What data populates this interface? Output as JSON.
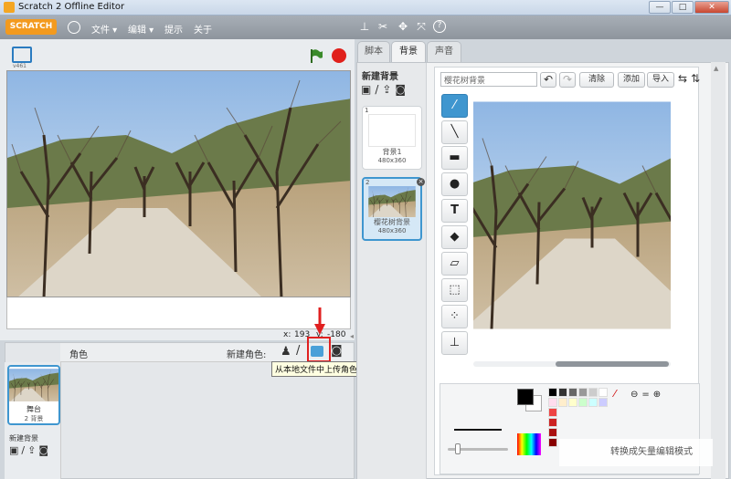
{
  "window": {
    "title": "Scratch 2 Offline Editor",
    "minimize": "—",
    "maximize": "□",
    "close": "✕"
  },
  "menubar": {
    "logo": "SCRATCH",
    "file": "文件 ▾",
    "edit": "编辑 ▾",
    "tips": "提示",
    "about": "关于"
  },
  "stage": {
    "version_label": "v461",
    "coord_x_label": "x:",
    "coord_x": "193",
    "coord_y_label": "y:",
    "coord_y": "-180"
  },
  "sprites": {
    "header_label": "角色",
    "new_sprite_label": "新建角色:",
    "stage_name": "舞台",
    "stage_backdrops": "2 背景",
    "new_backdrop_label": "新建背景",
    "tooltip": "从本地文件中上传角色"
  },
  "tabs": [
    "脚本",
    "背景",
    "声音"
  ],
  "backdrops": {
    "new_label": "新建背景",
    "items": [
      {
        "index": "1",
        "name": "背景1",
        "size": "480x360"
      },
      {
        "index": "2",
        "name": "樱花树背景",
        "size": "480x360"
      }
    ]
  },
  "editor": {
    "name_value": "樱花树背景",
    "clear_label": "清除",
    "add_label": "添加",
    "import_label": "导入"
  },
  "palette": {
    "watermark": "转换成矢量编辑模式"
  },
  "colors": {
    "accent": "#3f96cf",
    "menu_bg": "#9aa1a9",
    "logo": "#f39a1e",
    "stop": "#e0201b",
    "flag": "#3a8a2a"
  }
}
